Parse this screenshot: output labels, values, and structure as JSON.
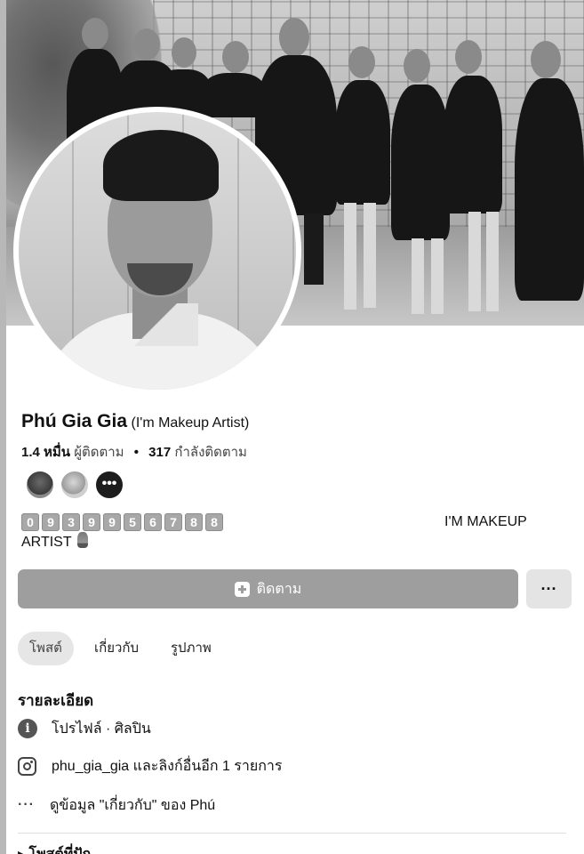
{
  "profile": {
    "name": "Phú Gia Gia",
    "alternate_name": "(I'm Makeup Artist)",
    "followers_count": "1.4 หมื่น",
    "followers_label": "ผู้ติดตาม",
    "following_count": "317",
    "following_label": "กำลังติดตาม",
    "friend_more_icon": "•••"
  },
  "bio": {
    "phone_digits": [
      "0",
      "9",
      "3",
      "9",
      "9",
      "5",
      "6",
      "7",
      "8",
      "8"
    ],
    "right_text": "I'M MAKEUP",
    "line2": "ARTIST"
  },
  "actions": {
    "follow_label": "ติดตาม",
    "more_label": "···"
  },
  "tabs": [
    {
      "label": "โพสต์",
      "active": true
    },
    {
      "label": "เกี่ยวกับ",
      "active": false
    },
    {
      "label": "รูปภาพ",
      "active": false
    }
  ],
  "details": {
    "title": "รายละเอียด",
    "profile_category": "โปรไฟล์ · ศิลปิน",
    "instagram": "phu_gia_gia และลิงก์อื่นอีก 1 รายการ",
    "about_link": "ดูข้อมูล \"เกี่ยวกับ\" ของ Phú",
    "next_section": "โพสต์ที่ปัก"
  },
  "colors": {
    "follow_button_bg": "#9e9e9e",
    "more_button_bg": "#e4e4e4",
    "active_tab_bg": "#e6e6e6"
  }
}
